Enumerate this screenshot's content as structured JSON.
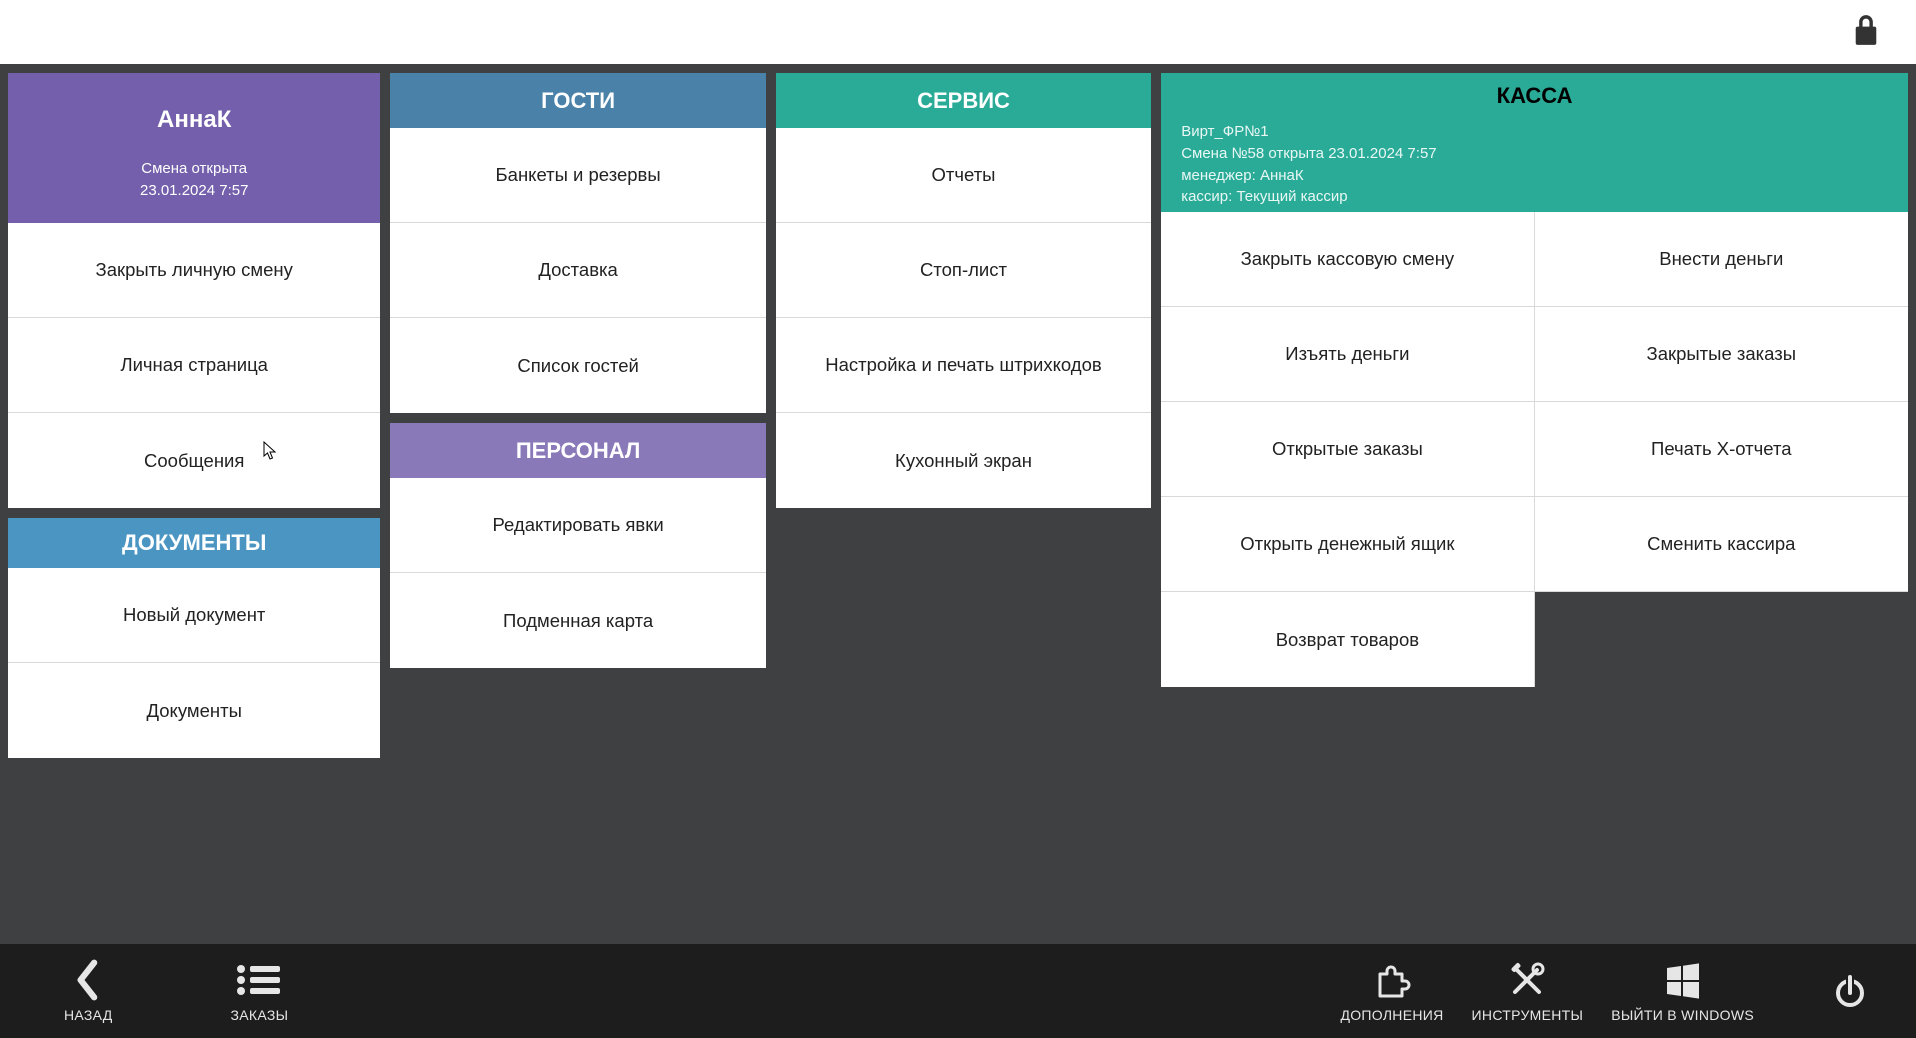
{
  "topbar": {
    "lock_alt": "lock"
  },
  "user": {
    "name": "АннаК",
    "shift_status": "Смена открыта",
    "shift_time": "23.01.2024 7:57",
    "buttons": [
      "Закрыть личную смену",
      "Личная страница",
      "Сообщения"
    ]
  },
  "documents": {
    "title": "ДОКУМЕНТЫ",
    "buttons": [
      "Новый документ",
      "Документы"
    ]
  },
  "guests": {
    "title": "ГОСТИ",
    "buttons": [
      "Банкеты и резервы",
      "Доставка",
      "Список гостей"
    ]
  },
  "staff": {
    "title": "ПЕРСОНАЛ",
    "buttons": [
      "Редактировать явки",
      "Подменная карта"
    ]
  },
  "service": {
    "title": "СЕРВИС",
    "buttons": [
      "Отчеты",
      "Стоп-лист",
      "Настройка и печать штрихкодов",
      "Кухонный экран"
    ]
  },
  "kassa": {
    "title": "КАССА",
    "line1": "Вирт_ФР№1",
    "line2": "Смена №58 открыта 23.01.2024 7:57",
    "line3": "менеджер: АннаК",
    "line4": "кассир: Текущий кассир",
    "grid": [
      "Закрыть кассовую смену",
      "Внести деньги",
      "Изъять деньги",
      "Закрытые заказы",
      "Открытые заказы",
      "Печать X-отчета",
      "Открыть денежный ящик",
      "Сменить кассира",
      "Возврат товаров"
    ]
  },
  "footer": {
    "back": "НАЗАД",
    "orders": "ЗАКАЗЫ",
    "addons": "ДОПОЛНЕНИЯ",
    "tools": "ИНСТРУМЕНТЫ",
    "exit": "ВЫЙТИ В WINDOWS",
    "power_alt": "power"
  }
}
